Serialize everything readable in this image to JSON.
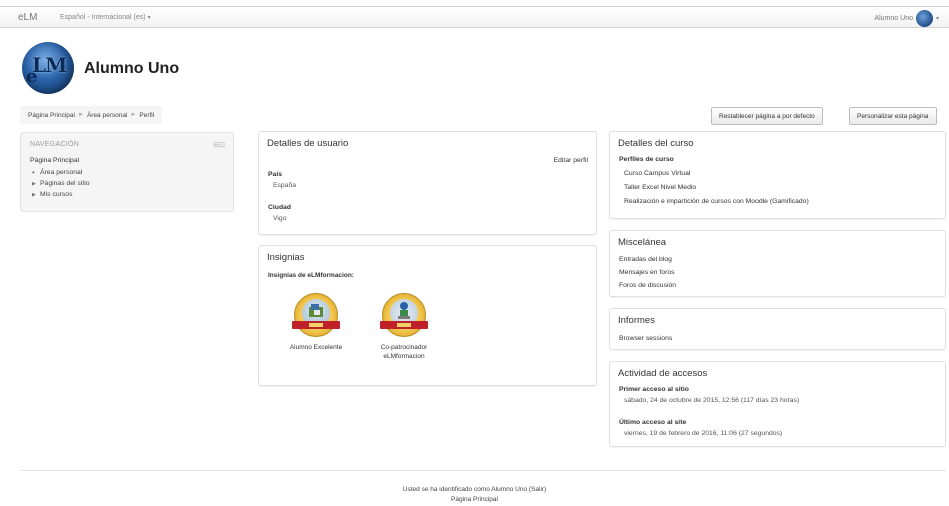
{
  "navbar": {
    "brand": "eLM",
    "language": "Español - Internacional (es)",
    "language_caret": "▾",
    "user_name": "Alumno Uno",
    "user_caret": "▾"
  },
  "header": {
    "avatar_logo_top": "LM",
    "avatar_logo_e": "e",
    "title": "Alumno Uno"
  },
  "breadcrumb": {
    "items": [
      "Página Principal",
      "Área personal",
      "Perfil"
    ],
    "separator": "►"
  },
  "buttons": {
    "reset": "Restablecer página a por defecto",
    "customize": "Personalizar esta página"
  },
  "navigation": {
    "title": "NAVEGACIÓN",
    "controls": "⊟⊡",
    "home": "Página Principal",
    "items": [
      {
        "marker": "•",
        "label": "Área personal"
      },
      {
        "marker": "▶",
        "label": "Páginas del sitio"
      },
      {
        "marker": "▶",
        "label": "Mis cursos"
      }
    ]
  },
  "user_details": {
    "title": "Detalles de usuario",
    "edit_link": "Editar perfil",
    "country_label": "País",
    "country_value": "España",
    "city_label": "Ciudad",
    "city_value": "Vigo"
  },
  "badges": {
    "title": "Insignias",
    "subtitle": "Insignias de eLMformacion:",
    "items": [
      {
        "name_line1": "Alumno Excelente",
        "name_line2": ""
      },
      {
        "name_line1": "Co-patrocinador",
        "name_line2": "eLMformacion"
      }
    ]
  },
  "course_details": {
    "title": "Detalles del curso",
    "profiles_label": "Perfiles de curso",
    "courses": [
      "Curso Campus Virtual",
      "Taller Excel Nivel Medio",
      "Realización e impartición de cursos con Moodle (Gamificado)"
    ]
  },
  "misc": {
    "title": "Miscelánea",
    "links": [
      "Entradas del blog",
      "Mensajes en foros",
      "Foros de discusión"
    ]
  },
  "reports": {
    "title": "Informes",
    "links": [
      "Browser sessions"
    ]
  },
  "access": {
    "title": "Actividad de accesos",
    "first_label": "Primer acceso al sitio",
    "first_value": "sábado, 24 de octubre de 2015, 12:56  (117 días 23 horas)",
    "last_label": "Último acceso al site",
    "last_value": "viernes, 19 de febrero de 2016, 11:06  (27 segundos)"
  },
  "footer": {
    "logged_in": "Usted se ha identificado como Alumno Uno (Salir)",
    "home_link": "Página Principal"
  },
  "colors": {
    "navbar_bg": "#f5f5f5",
    "block_bg": "#f5f5f5",
    "badge_gold": "#f2c64c",
    "badge_ribbon": "#c0202a",
    "avatar_blue": "#2a62a8"
  }
}
